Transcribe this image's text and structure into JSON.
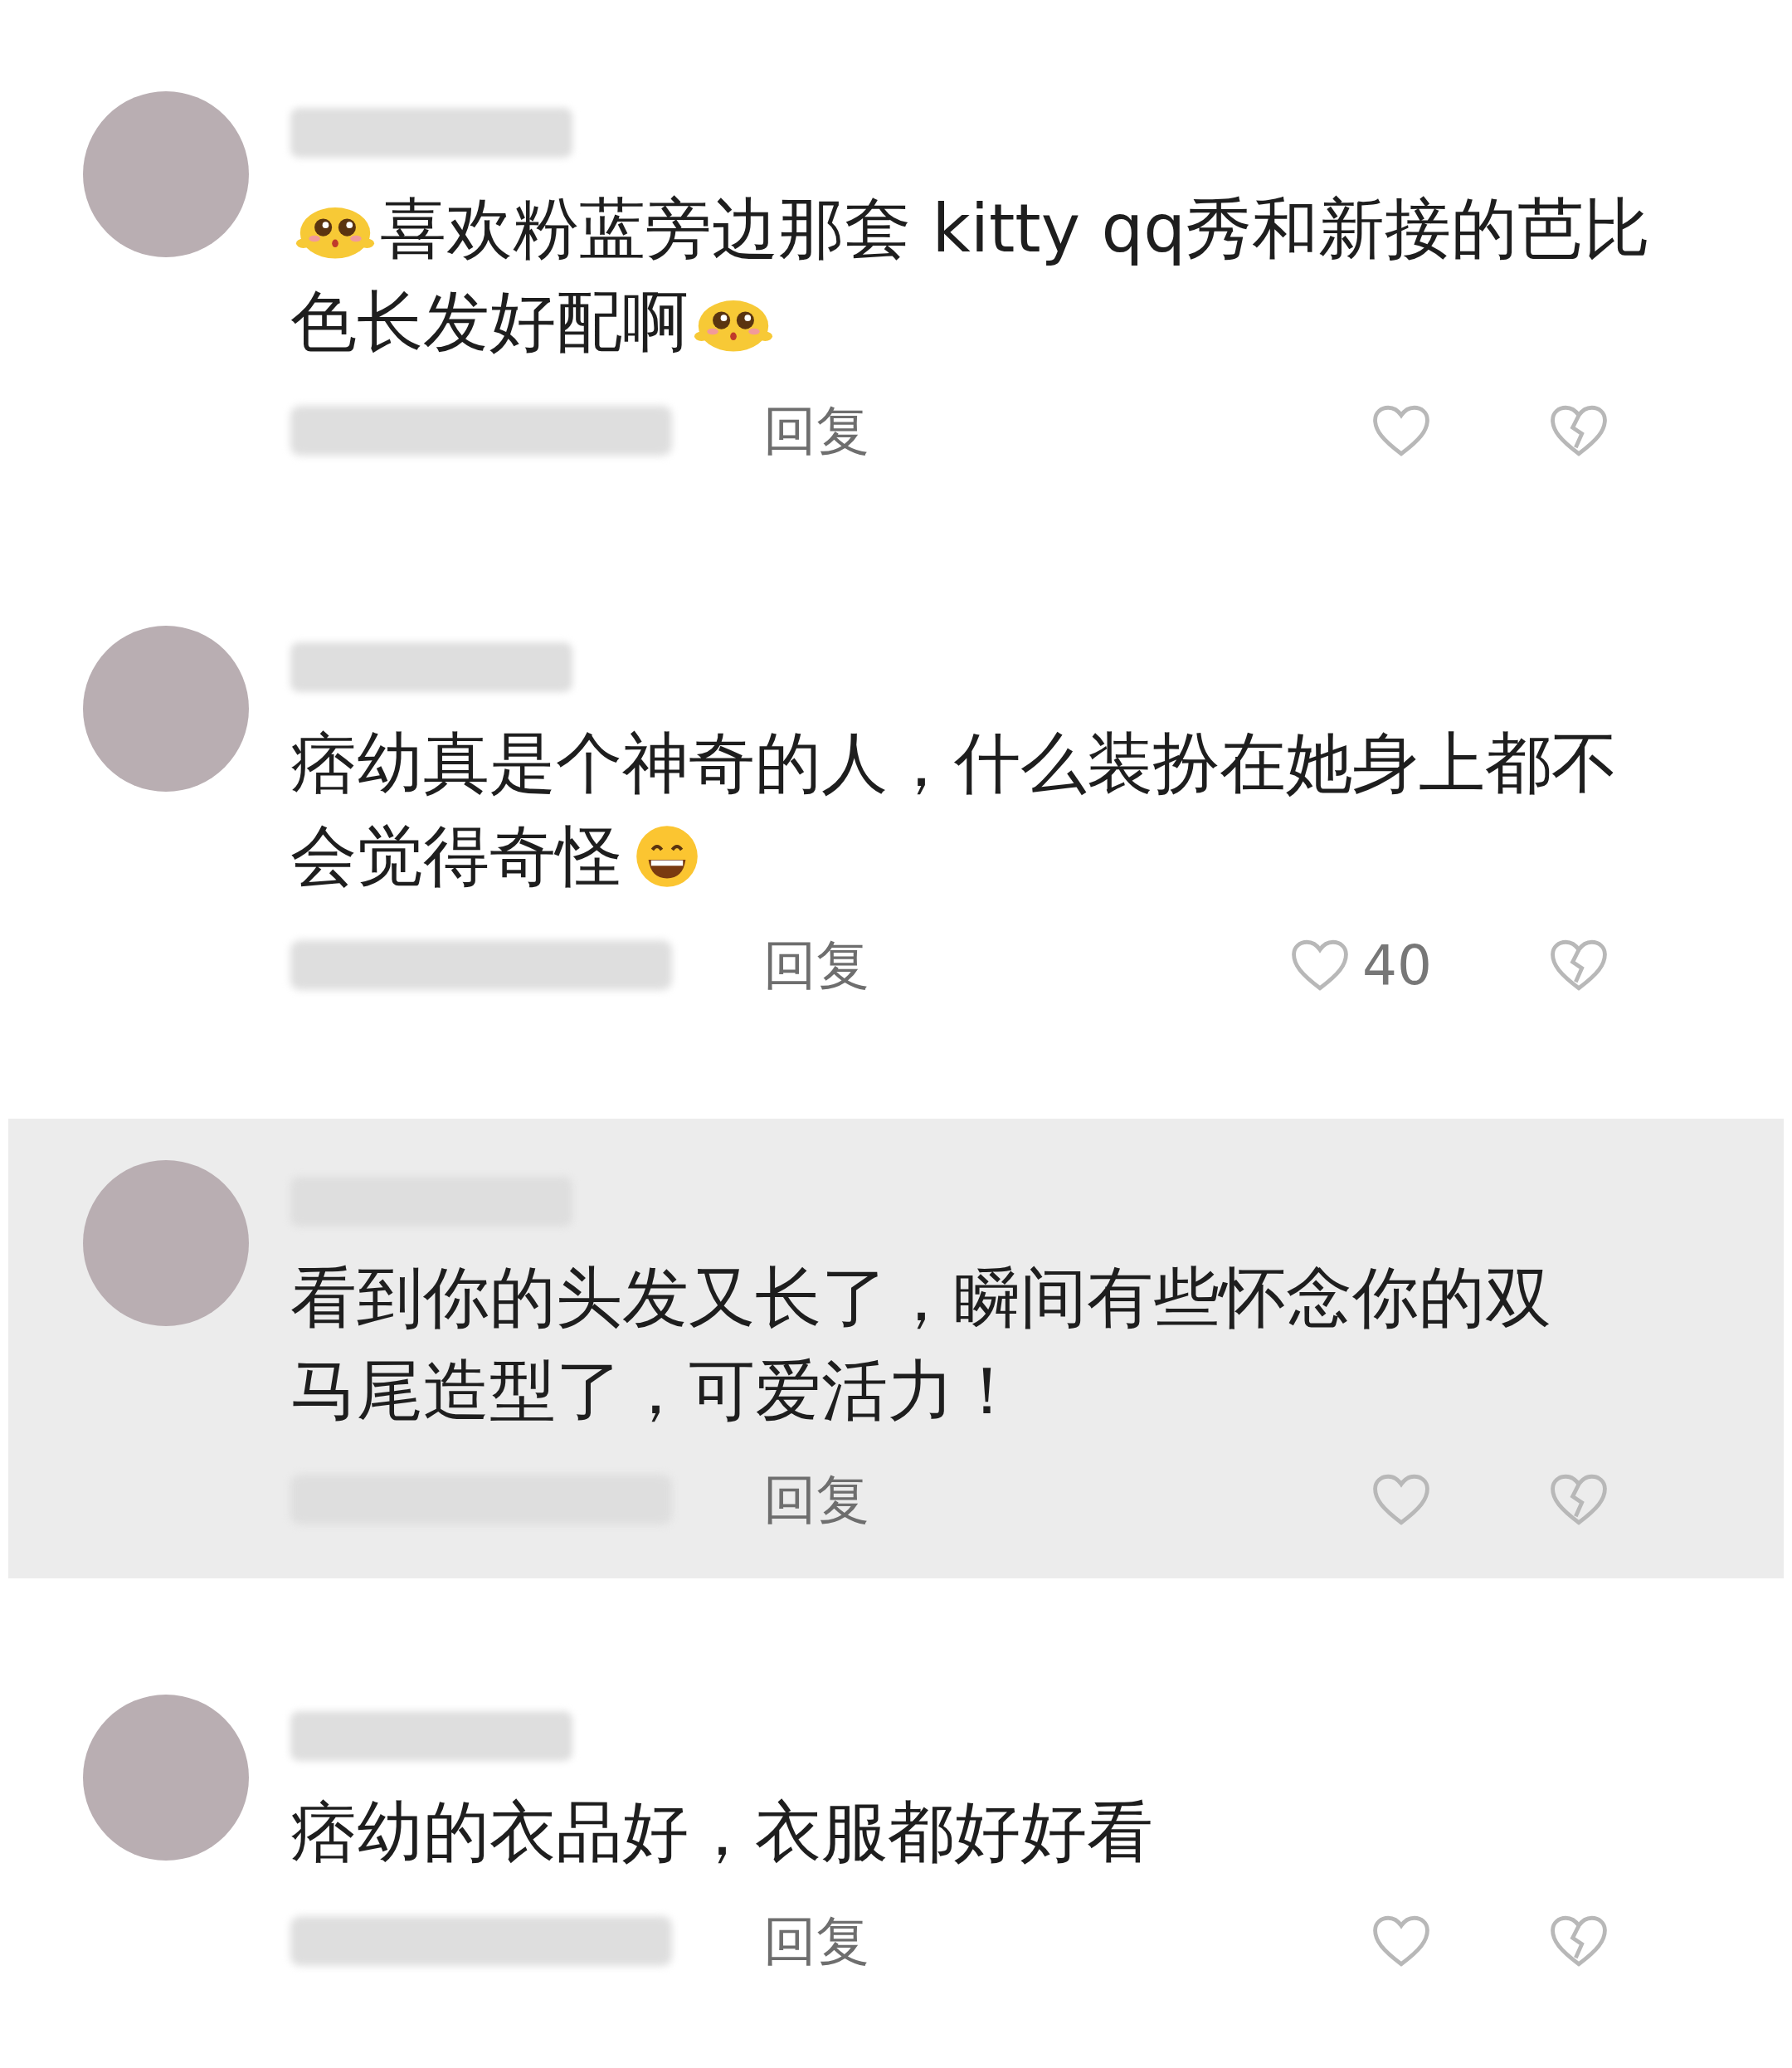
{
  "comments": [
    {
      "highlighted": false,
      "lines": [
        [
          {
            "kind": "shy"
          },
          {
            "kind": "text",
            "text": "喜欢粉蓝旁边那套 kitty qq秀和新接的芭比"
          }
        ],
        [
          {
            "kind": "text",
            "text": "色长发好配啊"
          },
          {
            "kind": "shy"
          }
        ]
      ],
      "reply": "回复"
    },
    {
      "highlighted": false,
      "lines": [
        [
          {
            "kind": "text",
            "text": "痞幼真是个神奇的人，什么装扮在她身上都不"
          }
        ],
        [
          {
            "kind": "text",
            "text": "会觉得奇怪"
          },
          {
            "kind": "grin"
          }
        ]
      ],
      "reply": "回复",
      "like_count": "40"
    },
    {
      "highlighted": true,
      "lines": [
        [
          {
            "kind": "text",
            "text": "看到你的头发又长了，瞬间有些怀念你的双"
          }
        ],
        [
          {
            "kind": "text",
            "text": "马尾造型了，可爱活力！"
          }
        ]
      ],
      "reply": "回复"
    },
    {
      "highlighted": false,
      "lines": [
        [
          {
            "kind": "text",
            "text": "痞幼的衣品好，衣服都好好看"
          }
        ]
      ],
      "reply": "回复"
    }
  ]
}
